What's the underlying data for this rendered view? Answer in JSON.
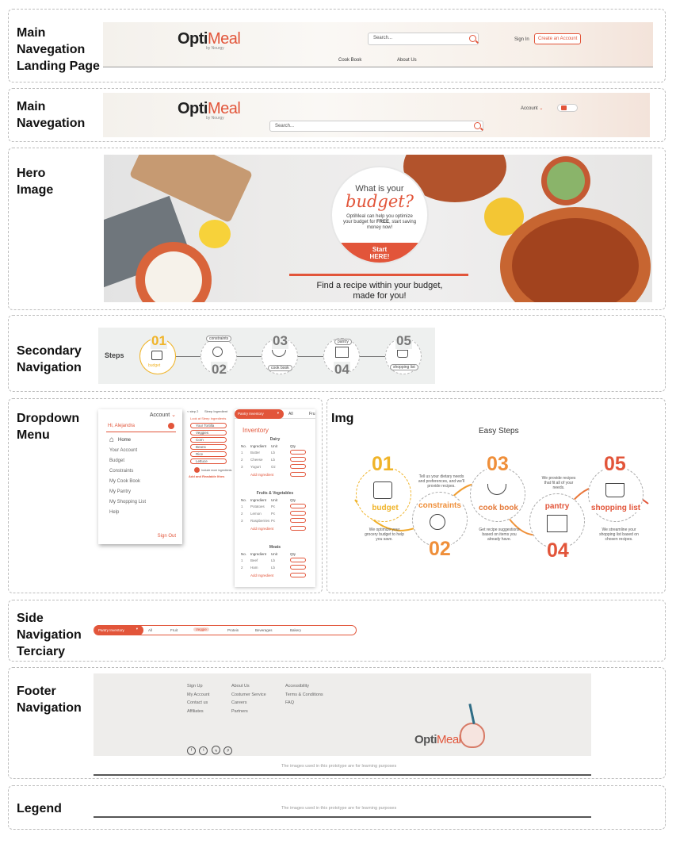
{
  "sections": {
    "main_nav_landing": "Main\nNavegation\nLanding Page",
    "main_nav": "Main\nNavegation",
    "hero": "Hero\nImage",
    "secondary_nav": "Secondary\nNavigation",
    "dropdown": "Dropdown\nMenu",
    "img": "Img",
    "side_nav": "Side\nNavigation\nTerciary",
    "footer_nav": "Footer\nNavigation",
    "legend": "Legend"
  },
  "brand": {
    "name_a": "Opti",
    "name_b": "Meal",
    "sub": "by Nourgy"
  },
  "landing_nav": {
    "search_placeholder": "Search...",
    "sign_in": "Sign In",
    "create_account": "Create an Account",
    "links": [
      "Cook Book",
      "About Us"
    ]
  },
  "main_nav": {
    "account": "Account",
    "search_placeholder": "Search..."
  },
  "hero": {
    "q1": "What is your",
    "q2": "budget?",
    "body_a": "OptiMeal can help you optimize your budget for ",
    "body_free": "FREE",
    "body_b": ", start saving money now!",
    "cta": "Start\nHERE!",
    "caption": "Find a recipe within your budget,\nmade for you!"
  },
  "steps": {
    "title": "Steps",
    "items": [
      {
        "num": "01",
        "label": "budget"
      },
      {
        "num": "02",
        "label": "constraints"
      },
      {
        "num": "03",
        "label": "cook book"
      },
      {
        "num": "04",
        "label": "pantry"
      },
      {
        "num": "05",
        "label": "shopping list"
      }
    ]
  },
  "dropdown": {
    "account": "Account",
    "greeting": "Hi, Alejandra",
    "items": [
      "Home",
      "Your Account",
      "Budget",
      "Constraints",
      "My Cook Book",
      "My Pantry",
      "My Shopping List",
      "Help"
    ],
    "sign_out": "Sign Out"
  },
  "constraints_panel": {
    "back": "< step 2",
    "sort": "Sleep Ingredient",
    "hint": "Look at Sleep Ingredients",
    "chips": [
      "Your Tortilla",
      "Veggies",
      "Corn",
      "Beans",
      "Rice",
      "Lettuce"
    ],
    "add": "Include more ingredients",
    "add_label": "Add and Readable Ithes"
  },
  "inventory": {
    "tabs": [
      "Pantry Inventory",
      "All",
      "Fru"
    ],
    "title": "Inventory",
    "columns": [
      "No.",
      "Ingredient",
      "Unit",
      "Qty"
    ],
    "groups": [
      {
        "name": "Dairy",
        "rows": [
          [
            "1",
            "Butter",
            "Lb"
          ],
          [
            "2",
            "Cheese",
            "Lb"
          ],
          [
            "3",
            "Yogurt",
            "Oz"
          ]
        ]
      },
      {
        "name": "Fruits & Vegetables",
        "rows": [
          [
            "1",
            "Potatoes",
            "Pc"
          ],
          [
            "2",
            "Lemon",
            "Pc"
          ],
          [
            "3",
            "Raspberries",
            "Pc"
          ]
        ]
      },
      {
        "name": "Meats",
        "rows": [
          [
            "1",
            "Beef",
            "Lb"
          ],
          [
            "2",
            "Ham",
            "Lb"
          ]
        ]
      }
    ],
    "add_ingredient": "Add Ingredient"
  },
  "easy_steps": {
    "title": "Easy Steps",
    "items": [
      {
        "num": "01",
        "label": "budget",
        "desc": "We optimize your grocery budget to help you save."
      },
      {
        "num": "02",
        "label": "constraints",
        "desc": "Tell us your dietary needs and preferences, and we'll provide recipes."
      },
      {
        "num": "03",
        "label": "cook book",
        "desc": "Get recipe suggestions based on items you already have."
      },
      {
        "num": "04",
        "label": "pantry",
        "desc": "We provide recipes that fit all of your needs."
      },
      {
        "num": "05",
        "label": "shopping list",
        "desc": "We streamline your shopping list based on chosen recipes."
      }
    ]
  },
  "side_nav": {
    "dropdown": "Pantry Inventory",
    "tabs": [
      "All",
      "Fruit",
      "Veggie",
      "Protein",
      "Beverages",
      "Bakery"
    ],
    "active": "Veggie"
  },
  "footer": {
    "col1": "Sign Up\nMy Account\nContact us\nAffiliates",
    "col2": "About Us\nCostumer Service\nCareers\nPartners",
    "col3": "Accessibility\nTerms & Conditions\nFAQ",
    "social": [
      "f",
      "t",
      "ig",
      "p"
    ],
    "note": "The images used in this prototype are for learning purposes"
  },
  "legend": {
    "note": "The images used in this prototype are for learning purposes"
  },
  "colors": {
    "accent": "#e2553a",
    "yellow": "#f0b429",
    "orange": "#ef8f3a"
  }
}
